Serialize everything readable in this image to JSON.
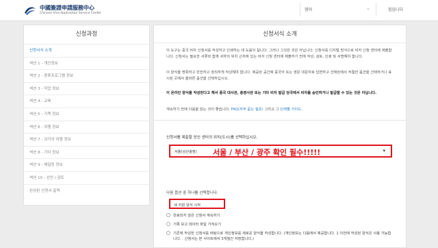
{
  "header": {
    "logo_cn": "中國簽證申請服務中心",
    "logo_en": "Chinese Visa Application Service Center",
    "language": "영어",
    "login": "집입니다"
  },
  "sidebar": {
    "title": "신청과정",
    "items": [
      "신청서식 소개",
      "섹션 1 - 개인정보",
      "섹션 2 - 종류프로그램 정보",
      "섹션 3 - 작업 정보",
      "섹션 4 - 교육",
      "섹션 5 - 가족 정보",
      "섹션 6 - 여행 정보",
      "섹션 7 - 과거의 여행 정보",
      "섹션 8 - 기타 정보",
      "섹션 9 - 해일링 정보",
      "섹션 10 - 선언 / 검토",
      "완성된 신청서 출력"
    ]
  },
  "main": {
    "title": "신청서식 소개",
    "p1": "이 도구는 중국 비자 신청서를 작성하고 인쇄하는 데 도움이 됩니다. 그러나 그것은 것은 아닙니다. 신청서를 디지털 방식으로 비자 신청 센터에 제출합니다. 신청서는 필요한 서류와 함께 귀하의 위치 근처에 있는 비자 신청 센터에 제출하기 전에 작성, 검토, 인쇄 및 서명해야 합니다.",
    "p2": "이 양식을 명확하고 완전하고 정직하게 작성해야 합니다. 제공된 공간에 중국어 또는 영문 대문자로 답변하고 선택란에서 적절한 옵션을 선택하거나 표시된 곳에서 올바른 옵션을 선택하십시오.",
    "p3": "이 온라인 양식을 작성한다고 해서 중국 대사관, 총영사관 또는 기타 비자 발급 당국에서 비자를 승인하거나 발급할 수 있는 것은 아닙니다.",
    "p4_prefix": "계속하기 전에 다음을 읽는 것이 좋습니다. ",
    "p4_link1": "FAQ(자주 묻는 질문)",
    "p4_mid": " 그리고 그 ",
    "p4_link2": "단계별 가이드.",
    "center_question": "신청서를 제출할 당신 센터의 위치(도시)를 선택하십시오.",
    "center_value": "서울(남산광장)",
    "center_note": "서울 / 부산 / 광주 확인 필수!!!!!",
    "options_question": "다음 옵션 중 하나를 선택합니다.",
    "options": [
      "새 지원 양식 시작",
      "완료되지 않은 신청서 계속하기",
      "기록 보고 데이터 파일 가져오기",
      "기존에 작성한 신청서를 바탕으로 개인정보를 새로운 양식을 작성합니다. (개인정보는 다음에서 제공합니다. 1 이전에 작성된 양식은 사용 가능합니다. . 신청서는 본 사이트에서 3개월간 저장합니다.)"
    ]
  },
  "colors": {
    "accent": "#2a7fc7",
    "highlight": "#e0121b"
  }
}
